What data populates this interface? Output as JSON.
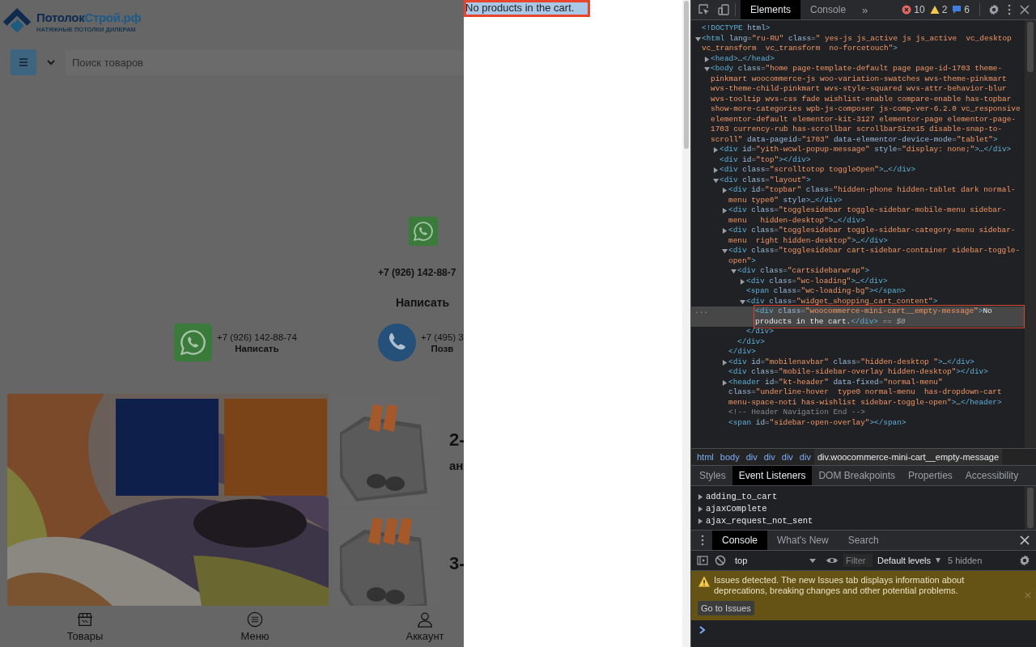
{
  "page": {
    "logo": {
      "wordmark": [
        {
          "text": "Потолок",
          "color": "#0f2a52"
        },
        {
          "text": "Строй.рф",
          "color": "#1c5b87"
        }
      ],
      "tagline": "НАТЯЖНЫЕ ПОТОЛКИ ДИЛЕРАМ"
    },
    "search": {
      "placeholder": "Поиск товаров"
    },
    "contact_top": {
      "phone": "+7 (926) 142-88-7",
      "action": "Написать"
    },
    "contacts": [
      {
        "kind": "whatsapp",
        "phone": "+7 (926) 142-88-74",
        "action": "Написать"
      },
      {
        "kind": "phone",
        "phone": "+7 (495) 3",
        "action": "Позв"
      }
    ],
    "products": [
      {
        "title": "2-",
        "subtitle": "ан"
      },
      {
        "title": "3-"
      }
    ],
    "bottom_nav": [
      {
        "kind": "store",
        "label": "Товары"
      },
      {
        "kind": "menu",
        "label": "Меню"
      },
      {
        "kind": "account",
        "label": "Аккаунт"
      }
    ]
  },
  "cart_sidebar": {
    "message": "No products in the cart.",
    "inspected": true
  },
  "devtools": {
    "tabs": [
      {
        "label": "Elements",
        "selected": true
      },
      {
        "label": "Console",
        "selected": false
      }
    ],
    "more_tabs": "»",
    "counts": [
      {
        "kind": "error",
        "count": "10"
      },
      {
        "kind": "warning",
        "count": "2"
      },
      {
        "kind": "info",
        "count": "6"
      }
    ],
    "dom_tree": [
      {
        "markup": "<!DOCTYPE html>",
        "selected": false
      },
      {
        "markup": "<html lang=\"ru-RU\" class=\" yes-js js_active js js_active  vc_desktop  vc_transform  vc_transform  no-forcetouch\">",
        "selected": false,
        "expanded": true,
        "children": [
          {
            "markup": "<head>…</head>",
            "selected": false,
            "expanded": false
          },
          {
            "markup": "<body class=\"home page-template-default page page-id-1703 theme-pinkmart woocommerce-js woo-variation-swatches wvs-theme-pinkmart wvs-theme-child-pinkmart wvs-style-squared wvs-attr-behavior-blur wvs-tooltip wvs-css fade wishlist-enable compare-enable has-topbar show-more-categories wpb-js-composer js-comp-ver-6.2.0 vc_responsive elementor-default elementor-kit-3127 elementor-page elementor-page-1703 currency-rub has-scrollbar scrollbarSize15 disable-snap-to-scroll\" data-pageid=\"1703\" data-elementor-device-mode=\"tablet\">",
            "selected": false,
            "expanded": true,
            "children": [
              {
                "markup": "<div id=\"yith-wcwl-popup-message\" style=\"display: none;\">…</div>",
                "selected": false,
                "expanded": false
              },
              {
                "markup": "<div id=\"top\"></div>",
                "selected": false
              },
              {
                "markup": "<div class=\"scrolltotop toggleOpen\">…</div>",
                "selected": false,
                "expanded": false
              },
              {
                "markup": "<div class=\"layout\">",
                "selected": false,
                "expanded": true,
                "children": [
                  {
                    "markup": "<div id=\"topbar\" class=\"hidden-phone hidden-tablet dark normal-menu type0\" style>…</div>",
                    "selected": false,
                    "expanded": false
                  },
                  {
                    "markup": "<div class=\"togglesidebar toggle-sidebar-mobile-menu sidebar-menu   hidden-desktop\">…</div>",
                    "selected": false,
                    "expanded": false
                  },
                  {
                    "markup": "<div class=\"togglesidebar toggle-sidebar-category-menu sidebar-menu  right hidden-desktop\">…</div>",
                    "selected": false,
                    "expanded": false
                  },
                  {
                    "markup": "<div class=\"togglesidebar cart-sidebar-container sidebar-toggle-open\">",
                    "selected": false,
                    "expanded": true,
                    "closing": "</div>",
                    "children": [
                      {
                        "markup": "<div class=\"cartsidebarwrap\">",
                        "selected": false,
                        "expanded": true,
                        "closing": "</div>",
                        "children": [
                          {
                            "markup": "<div class=\"wc-loading\">…</div>",
                            "selected": false,
                            "expanded": false
                          },
                          {
                            "markup": "<span class=\"wc-loading-bg\"></span>",
                            "selected": false
                          },
                          {
                            "markup": "<div class=\"widget_shopping_cart_content\">",
                            "selected": false,
                            "expanded": true,
                            "closing": "</div>",
                            "children": [
                              {
                                "markup": "<div class=\"woocommerce-mini-cart__empty-message\">No products in the cart.</div>",
                                "selected": true,
                                "ref": "== $0",
                                "gutter": "..."
                              }
                            ]
                          }
                        ]
                      }
                    ]
                  },
                  {
                    "markup": "<div id=\"mobilenavbar\" class=\"hidden-desktop \">…</div>",
                    "selected": false,
                    "expanded": false
                  },
                  {
                    "markup": "<div class=\"mobile-sidebar-overlay hidden-desktop\"></div>",
                    "selected": false
                  },
                  {
                    "markup": "<header id=\"kt-header\" data-fixed=\"normal-menu\" class=\"underline-hover  type0 normal-menu  has-dropdown-cart menu-space-noti has-wishlist sidebar-toggle-open\">…</header>",
                    "selected": false,
                    "expanded": false
                  },
                  {
                    "markup": "<!-- Header Navigation End -->",
                    "selected": false
                  },
                  {
                    "markup": "<span id=\"sidebar-open-overlay\"></span>",
                    "selected": false
                  }
                ]
              }
            ]
          }
        ]
      }
    ],
    "breadcrumbs": [
      {
        "label": "html",
        "selected": false
      },
      {
        "label": "body",
        "selected": false
      },
      {
        "label": "div",
        "selected": false
      },
      {
        "label": "div",
        "selected": false
      },
      {
        "label": "div",
        "selected": false
      },
      {
        "label": "div",
        "selected": false
      },
      {
        "label": "div.woocommerce-mini-cart__empty-message",
        "selected": true
      }
    ],
    "panel_tabs": [
      {
        "label": "Styles",
        "selected": false
      },
      {
        "label": "Event Listeners",
        "selected": true
      },
      {
        "label": "DOM Breakpoints",
        "selected": false
      },
      {
        "label": "Properties",
        "selected": false
      },
      {
        "label": "Accessibility",
        "selected": false
      }
    ],
    "listeners": [
      {
        "name": "adding_to_cart",
        "expanded": false
      },
      {
        "name": "ajaxComplete",
        "expanded": false
      },
      {
        "name": "ajax_request_not_sent",
        "expanded": false
      }
    ],
    "drawer_tabs": [
      {
        "label": "Console",
        "selected": true
      },
      {
        "label": "What's New",
        "selected": false
      },
      {
        "label": "Search",
        "selected": false
      }
    ],
    "console_toolbar": {
      "context": "top",
      "filter_placeholder": "Filter",
      "levels": "Default levels",
      "hidden": "5 hidden"
    },
    "issues_banner": {
      "text": "Issues detected. The new Issues tab displays information about deprecations, breaking changes and other potential problems.",
      "button": "Go to Issues"
    }
  }
}
